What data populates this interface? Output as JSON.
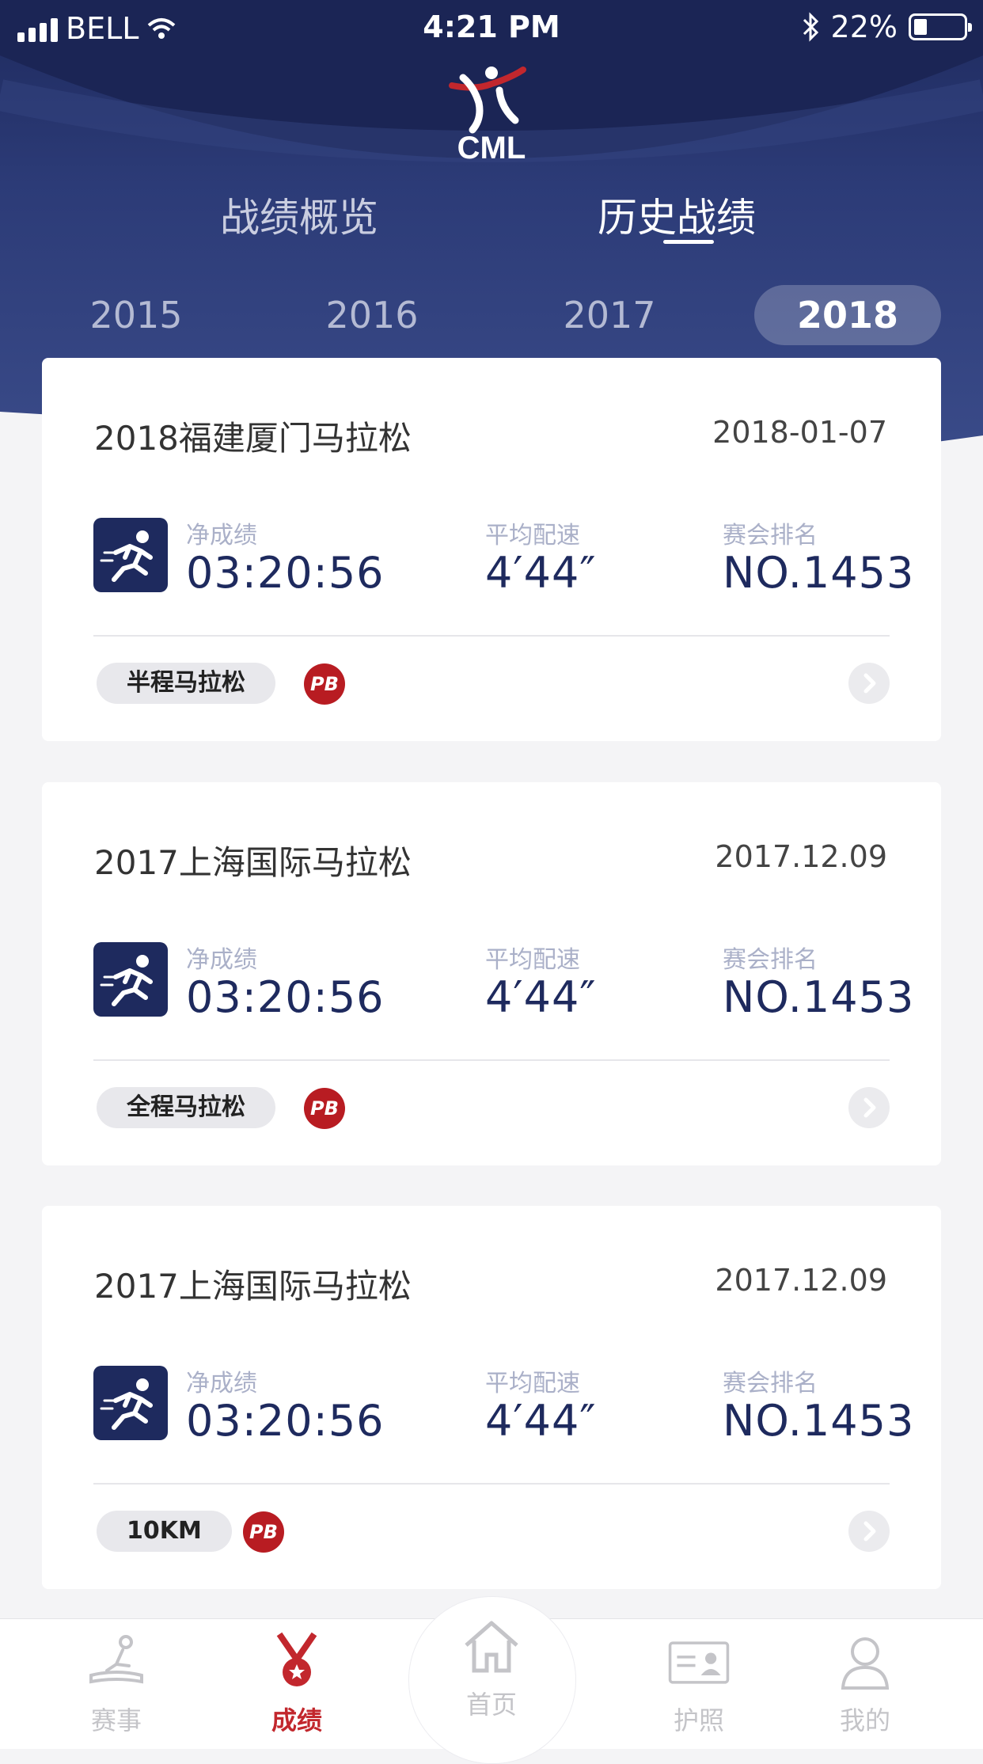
{
  "status_bar": {
    "carrier": "BELL",
    "time": "4:21 PM",
    "battery": "22%"
  },
  "brand": {
    "logo_text": "CML"
  },
  "tabs": [
    {
      "label": "战绩概览",
      "active": false
    },
    {
      "label": "历史战绩",
      "active": true
    }
  ],
  "years": [
    {
      "label": "2015",
      "active": false
    },
    {
      "label": "2016",
      "active": false
    },
    {
      "label": "2017",
      "active": false
    },
    {
      "label": "2018",
      "active": true
    }
  ],
  "records": [
    {
      "title": "2018福建厦门马拉松",
      "date": "2018-01-07",
      "net_time_label": "净成绩",
      "net_time": "03:20:56",
      "pace_label": "平均配速",
      "pace": "4′44″",
      "rank_label": "赛会排名",
      "rank": "NO.1453",
      "category": "半程马拉松",
      "badge": "PB"
    },
    {
      "title": "2017上海国际马拉松",
      "date": "2017.12.09",
      "net_time_label": "净成绩",
      "net_time": "03:20:56",
      "pace_label": "平均配速",
      "pace": "4′44″",
      "rank_label": "赛会排名",
      "rank": "NO.1453",
      "category": "全程马拉松",
      "badge": "PB"
    },
    {
      "title": "2017上海国际马拉松",
      "date": "2017.12.09",
      "net_time_label": "净成绩",
      "net_time": "03:20:56",
      "pace_label": "平均配速",
      "pace": "4′44″",
      "rank_label": "赛会排名",
      "rank": "NO.1453",
      "category": "10KM",
      "badge": "PB"
    }
  ],
  "tabbar": [
    {
      "label": "赛事",
      "icon": "event-icon",
      "active": false
    },
    {
      "label": "成绩",
      "icon": "medal-icon",
      "active": true
    },
    {
      "label": "首页",
      "icon": "home-icon",
      "active": false
    },
    {
      "label": "护照",
      "icon": "passport-icon",
      "active": false
    },
    {
      "label": "我的",
      "icon": "profile-icon",
      "active": false
    }
  ],
  "colors": {
    "navy": "#1e2a5e",
    "accent_red": "#c2272d",
    "pb_red": "#b81c22",
    "label_gray": "#aab0c8"
  }
}
